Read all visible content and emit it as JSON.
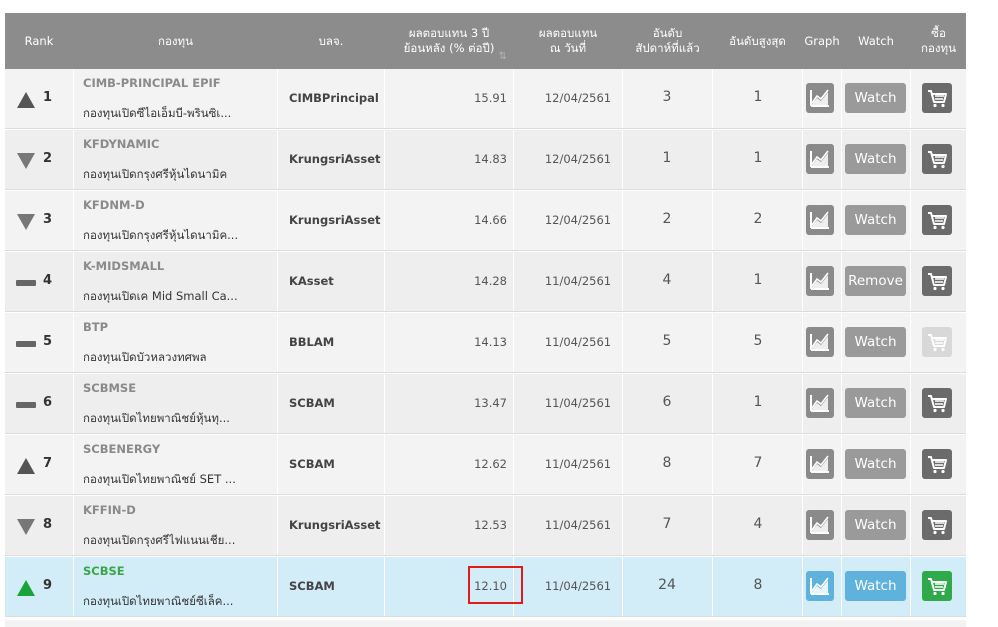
{
  "header": {
    "rank": "Rank",
    "fund": "กองทุน",
    "amc": "บลจ.",
    "return_line1": "ผลตอบแทน 3 ปี",
    "return_line2": "ย้อนหลัง (% ต่อปี)",
    "return_sort": "⇅",
    "asof_line1": "ผลตอบแทน",
    "asof_line2": "ณ วันที่",
    "weekrank_line1": "อันดับ",
    "weekrank_line2": "สัปดาห์ที่แล้ว",
    "bestrank": "อันดับสูงสุด",
    "graph": "Graph",
    "watch": "Watch",
    "buy_line1": "ซื้อ",
    "buy_line2": "กองทุน"
  },
  "rows": [
    {
      "rank": "1",
      "trend": "up",
      "code": "CIMB-PRINCIPAL EPIF",
      "name": "กองทุนเปิดซีไอเอ็มบี-พรินซิเ...",
      "amc": "CIMBPrincipal",
      "return": "15.91",
      "date": "12/04/2561",
      "week_rank": "3",
      "best_rank": "1",
      "watch": "Watch",
      "cart": "normal"
    },
    {
      "rank": "2",
      "trend": "down",
      "code": "KFDYNAMIC",
      "name": "กองทุนเปิดกรุงศรีหุ้นไดนามิค",
      "amc": "KrungsriAsset",
      "return": "14.83",
      "date": "12/04/2561",
      "week_rank": "1",
      "best_rank": "1",
      "watch": "Watch",
      "cart": "normal"
    },
    {
      "rank": "3",
      "trend": "down",
      "code": "KFDNM-D",
      "name": "กองทุนเปิดกรุงศรีหุ้นไดนามิค...",
      "amc": "KrungsriAsset",
      "return": "14.66",
      "date": "12/04/2561",
      "week_rank": "2",
      "best_rank": "2",
      "watch": "Watch",
      "cart": "normal"
    },
    {
      "rank": "4",
      "trend": "same",
      "code": "K-MIDSMALL",
      "name": "กองทุนเปิดเค Mid Small Ca...",
      "amc": "KAsset",
      "return": "14.28",
      "date": "11/04/2561",
      "week_rank": "4",
      "best_rank": "1",
      "watch": "Remove",
      "cart": "normal"
    },
    {
      "rank": "5",
      "trend": "same",
      "code": "BTP",
      "name": "กองทุนเปิดบัวหลวงทศพล",
      "amc": "BBLAM",
      "return": "14.13",
      "date": "11/04/2561",
      "week_rank": "5",
      "best_rank": "5",
      "watch": "Watch",
      "cart": "disabled"
    },
    {
      "rank": "6",
      "trend": "same",
      "code": "SCBMSE",
      "name": "กองทุนเปิดไทยพาณิชย์หุ้นทุ...",
      "amc": "SCBAM",
      "return": "13.47",
      "date": "11/04/2561",
      "week_rank": "6",
      "best_rank": "1",
      "watch": "Watch",
      "cart": "normal"
    },
    {
      "rank": "7",
      "trend": "up",
      "code": "SCBENERGY",
      "name": "กองทุนเปิดไทยพาณิชย์ SET ...",
      "amc": "SCBAM",
      "return": "12.62",
      "date": "11/04/2561",
      "week_rank": "8",
      "best_rank": "7",
      "watch": "Watch",
      "cart": "normal"
    },
    {
      "rank": "8",
      "trend": "down",
      "code": "KFFIN-D",
      "name": "กองทุนเปิดกรุงศรีไฟแนนเชีย...",
      "amc": "KrungsriAsset",
      "return": "12.53",
      "date": "11/04/2561",
      "week_rank": "7",
      "best_rank": "4",
      "watch": "Watch",
      "cart": "normal"
    },
    {
      "rank": "9",
      "trend": "up-green",
      "code": "SCBSE",
      "name": "กองทุนเปิดไทยพาณิชย์ซีเล็ค...",
      "amc": "SCBAM",
      "return": "12.10",
      "date": "11/04/2561",
      "week_rank": "24",
      "best_rank": "8",
      "watch": "Watch",
      "cart": "green",
      "highlighted": true
    }
  ],
  "colors": {
    "header_bg": "#8c8c8c",
    "highlight_row": "#d2ecf8",
    "accent_blue": "#5fb2dc",
    "accent_green": "#2faa4a",
    "trend_up": "#555555",
    "trend_up_green": "#1aa33a",
    "annotation_red": "#e01b1b"
  },
  "icons": {
    "graph": "line-chart-icon",
    "cart": "shopping-cart-icon",
    "trend_up": "triangle-up-icon",
    "trend_down": "triangle-down-icon",
    "trend_same": "dash-icon"
  }
}
